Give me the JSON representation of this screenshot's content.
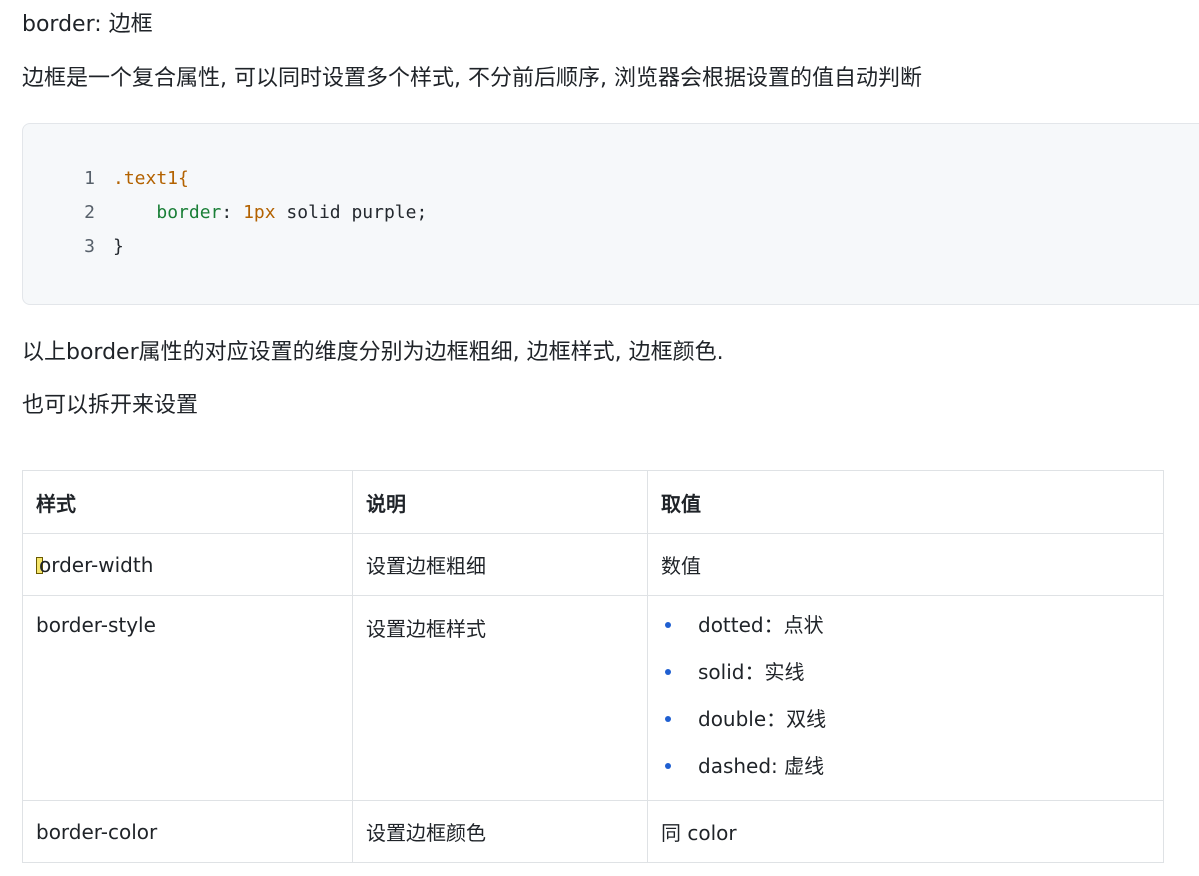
{
  "heading": "border: 边框",
  "intro": "边框是一个复合属性, 可以同时设置多个样式, 不分前后顺序, 浏览器会根据设置的值自动判断",
  "code": {
    "lines": [
      {
        "no": "1",
        "selector": ".text1{"
      },
      {
        "no": "2",
        "indent": "    ",
        "prop": "border",
        "colon": ": ",
        "num": "1px",
        "rest": " solid purple;"
      },
      {
        "no": "3",
        "text": "}"
      }
    ]
  },
  "para1": "以上border属性的对应设置的维度分别为边框粗细, 边框样式, 边框颜色.",
  "para2": "也可以拆开来设置",
  "table": {
    "headers": [
      "样式",
      "说明",
      "取值"
    ],
    "rows": [
      {
        "style": "order-width",
        "desc": "设置边框粗细",
        "value": "数值"
      },
      {
        "style": "border-style",
        "desc": "设置边框样式",
        "values": [
          "dotted：点状",
          "solid：实线",
          "double：双线",
          "dashed: 虚线"
        ]
      },
      {
        "style": "border-color",
        "desc": "设置边框颜色",
        "value": "同 color"
      }
    ]
  }
}
